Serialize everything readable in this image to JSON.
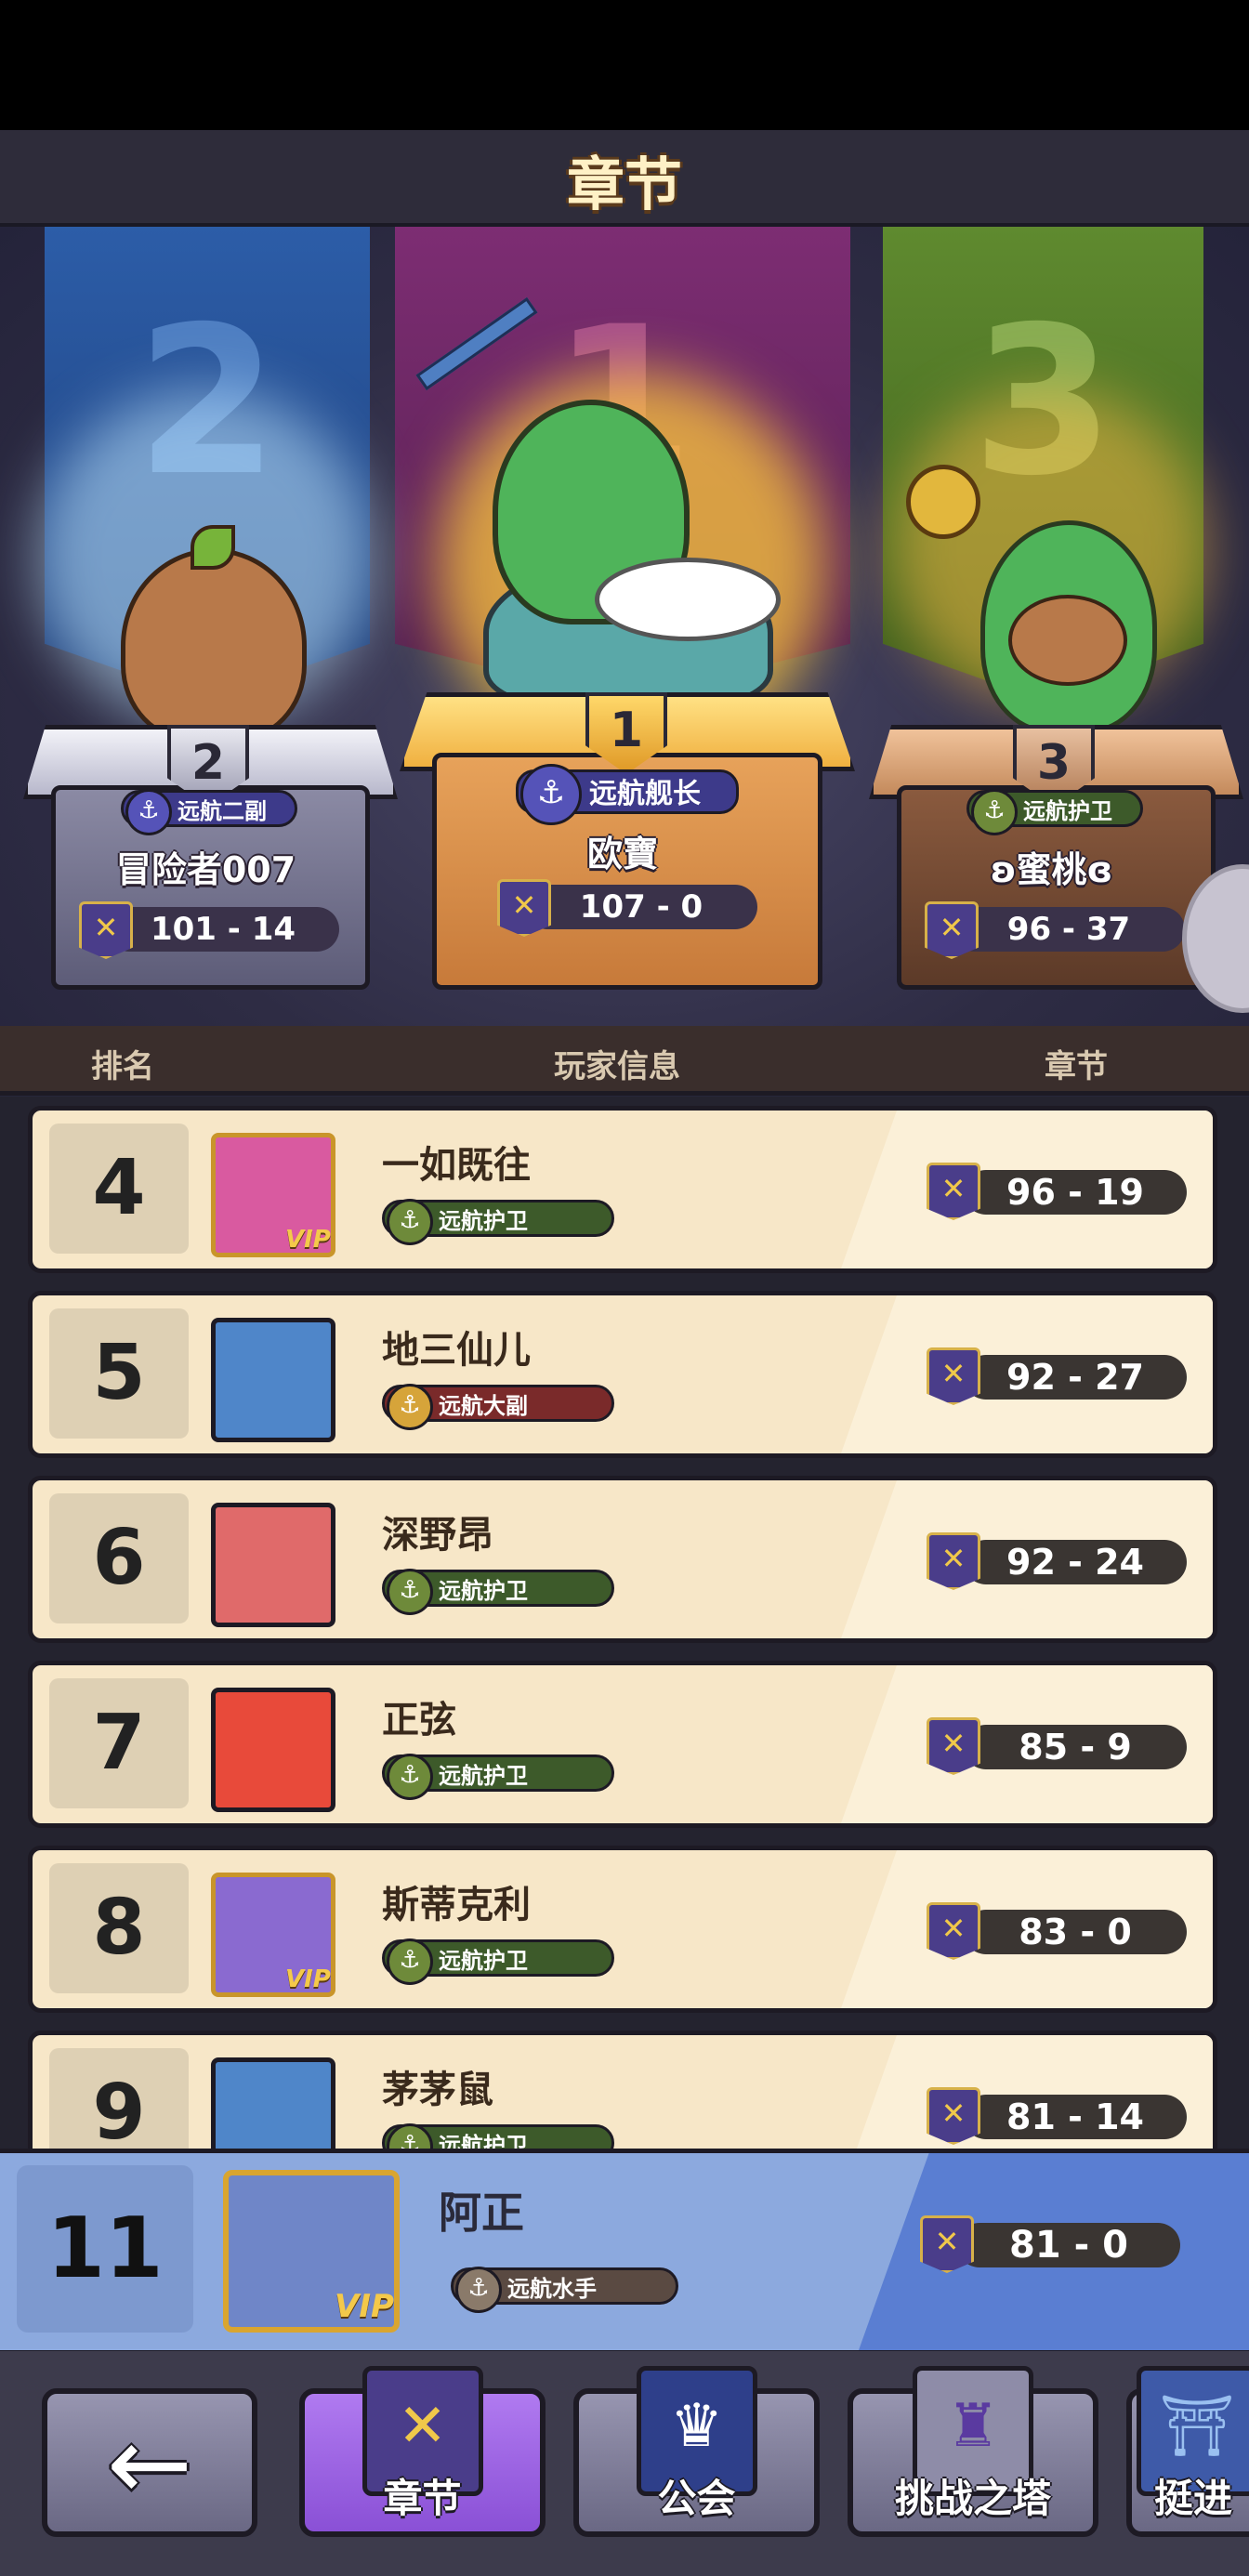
{
  "header": {
    "title": "章节"
  },
  "podium": {
    "second": {
      "rank": "2",
      "banner_number": "2",
      "title": "远航二副",
      "name": "冒险者007",
      "score": "101 - 14"
    },
    "first": {
      "rank": "1",
      "banner_number": "1",
      "title": "远航舰长",
      "name": "欧寶",
      "score": "107 - 0"
    },
    "third": {
      "rank": "3",
      "banner_number": "3",
      "title": "远航护卫",
      "name": "ʚ蜜桃ɞ",
      "score": "96 - 37"
    }
  },
  "columns": {
    "rank": "排名",
    "player": "玩家信息",
    "chapter": "章节"
  },
  "rows": [
    {
      "rank": "4",
      "name": "一如既往",
      "title": "远航护卫",
      "score": "96 - 19",
      "vip": "VIP"
    },
    {
      "rank": "5",
      "name": "地三仙儿",
      "title": "远航大副",
      "score": "92 - 27"
    },
    {
      "rank": "6",
      "name": "深野昂",
      "title": "远航护卫",
      "score": "92 - 24"
    },
    {
      "rank": "7",
      "name": "正弦",
      "title": "远航护卫",
      "score": "85 - 9"
    },
    {
      "rank": "8",
      "name": "斯蒂克利",
      "title": "远航护卫",
      "score": "83 - 0",
      "vip": "VIP"
    },
    {
      "rank": "9",
      "name": "茅茅鼠",
      "title": "远航护卫",
      "score": "81 - 14"
    }
  ],
  "me": {
    "rank": "11",
    "name": "阿正",
    "title": "远航水手",
    "score": "81 - 0",
    "vip": "VIP"
  },
  "nav": {
    "back_icon": "←",
    "items": [
      {
        "label": "章节",
        "icon": "sword-banner-icon"
      },
      {
        "label": "公会",
        "icon": "crown-banner-icon"
      },
      {
        "label": "挑战之塔",
        "icon": "tower-icon"
      },
      {
        "label": "挺进",
        "icon": "gate-icon"
      }
    ]
  },
  "icons": {
    "anchor": "⚓",
    "sword": "✕",
    "crown": "♛",
    "tower": "♜",
    "gate": "⛩"
  },
  "colors": {
    "banner_2": "#2c5da8",
    "banner_1": "#7d2d73",
    "banner_3": "#5f8a2f",
    "row_bg": "#f7e7c8",
    "my_row_bg": "#8ca9de",
    "nav_active": "#8a50d6"
  }
}
